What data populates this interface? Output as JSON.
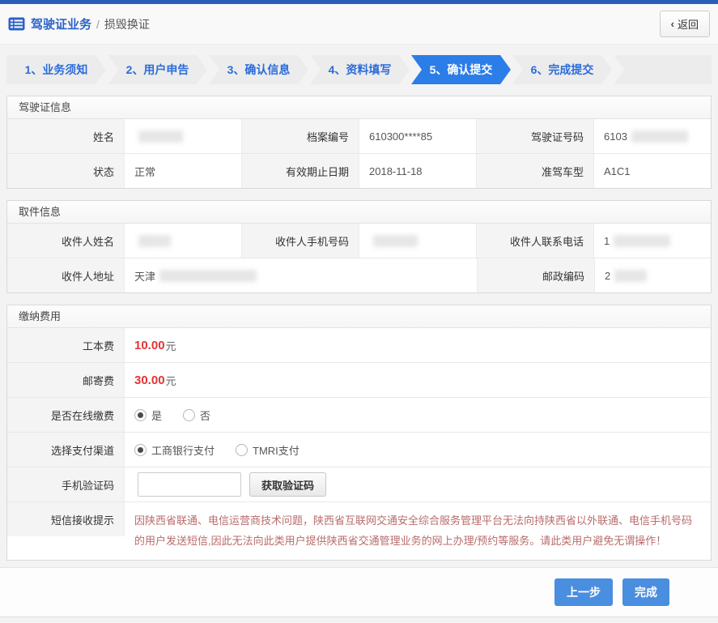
{
  "header": {
    "title": "驾驶证业务",
    "separator": "/",
    "subtitle": "损毁换证",
    "back_chevron": "‹",
    "back_label": "返回"
  },
  "steps": {
    "active_index": 4,
    "items": [
      {
        "label": "1、业务须知",
        "active": false
      },
      {
        "label": "2、用户申告",
        "active": false
      },
      {
        "label": "3、确认信息",
        "active": false
      },
      {
        "label": "4、资料填写",
        "active": false
      },
      {
        "label": "5、确认提交",
        "active": true
      },
      {
        "label": "6、完成提交",
        "active": false
      }
    ]
  },
  "license": {
    "title": "驾驶证信息",
    "name_label": "姓名",
    "name_value": "",
    "file_no_label": "档案编号",
    "file_no_value": "610300****85",
    "license_no_label": "驾驶证号码",
    "license_no_value": "6103",
    "status_label": "状态",
    "status_value": "正常",
    "expiry_label": "有效期止日期",
    "expiry_value": "2018-11-18",
    "vehicle_label": "准驾车型",
    "vehicle_value": "A1C1"
  },
  "pickup": {
    "title": "取件信息",
    "recipient_name_label": "收件人姓名",
    "recipient_name_value": "",
    "recipient_mobile_label": "收件人手机号码",
    "recipient_mobile_value": "",
    "recipient_phone_label": "收件人联系电话",
    "recipient_phone_value": "1",
    "address_label": "收件人地址",
    "address_value": "天津",
    "postcode_label": "邮政编码",
    "postcode_value": "2"
  },
  "payment": {
    "title": "缴纳费用",
    "production_fee_label": "工本费",
    "production_fee_amount": "10.00",
    "mailing_fee_label": "邮寄费",
    "mailing_fee_amount": "30.00",
    "fee_unit": "元",
    "online_pay_label": "是否在线缴费",
    "online_yes": "是",
    "online_no": "否",
    "online_selected": "是",
    "channel_label": "选择支付渠道",
    "channel_icbc": "工商银行支付",
    "channel_tmri": "TMRI支付",
    "channel_selected": "工商银行支付",
    "captcha_label": "手机验证码",
    "captcha_value": "",
    "captcha_button": "获取验证码",
    "sms_label": "短信接收提示",
    "sms_notice": "因陕西省联通、电信运营商技术问题，陕西省互联网交通安全综合服务管理平台无法向持陕西省以外联通、电信手机号码的用户发送短信,因此无法向此类用户提供陕西省交通管理业务的网上办理/预约等服务。请此类用户避免无谓操作！"
  },
  "footer": {
    "prev_label": "上一步",
    "finish_label": "完成"
  },
  "colors": {
    "topbar_blue": "#2a5db8",
    "step_active_blue": "#2b7de8",
    "step_text_blue": "#2b6cd9",
    "fee_red": "#e23434",
    "notice_red": "#b96b6b",
    "button_blue": "#4a8ee0"
  }
}
